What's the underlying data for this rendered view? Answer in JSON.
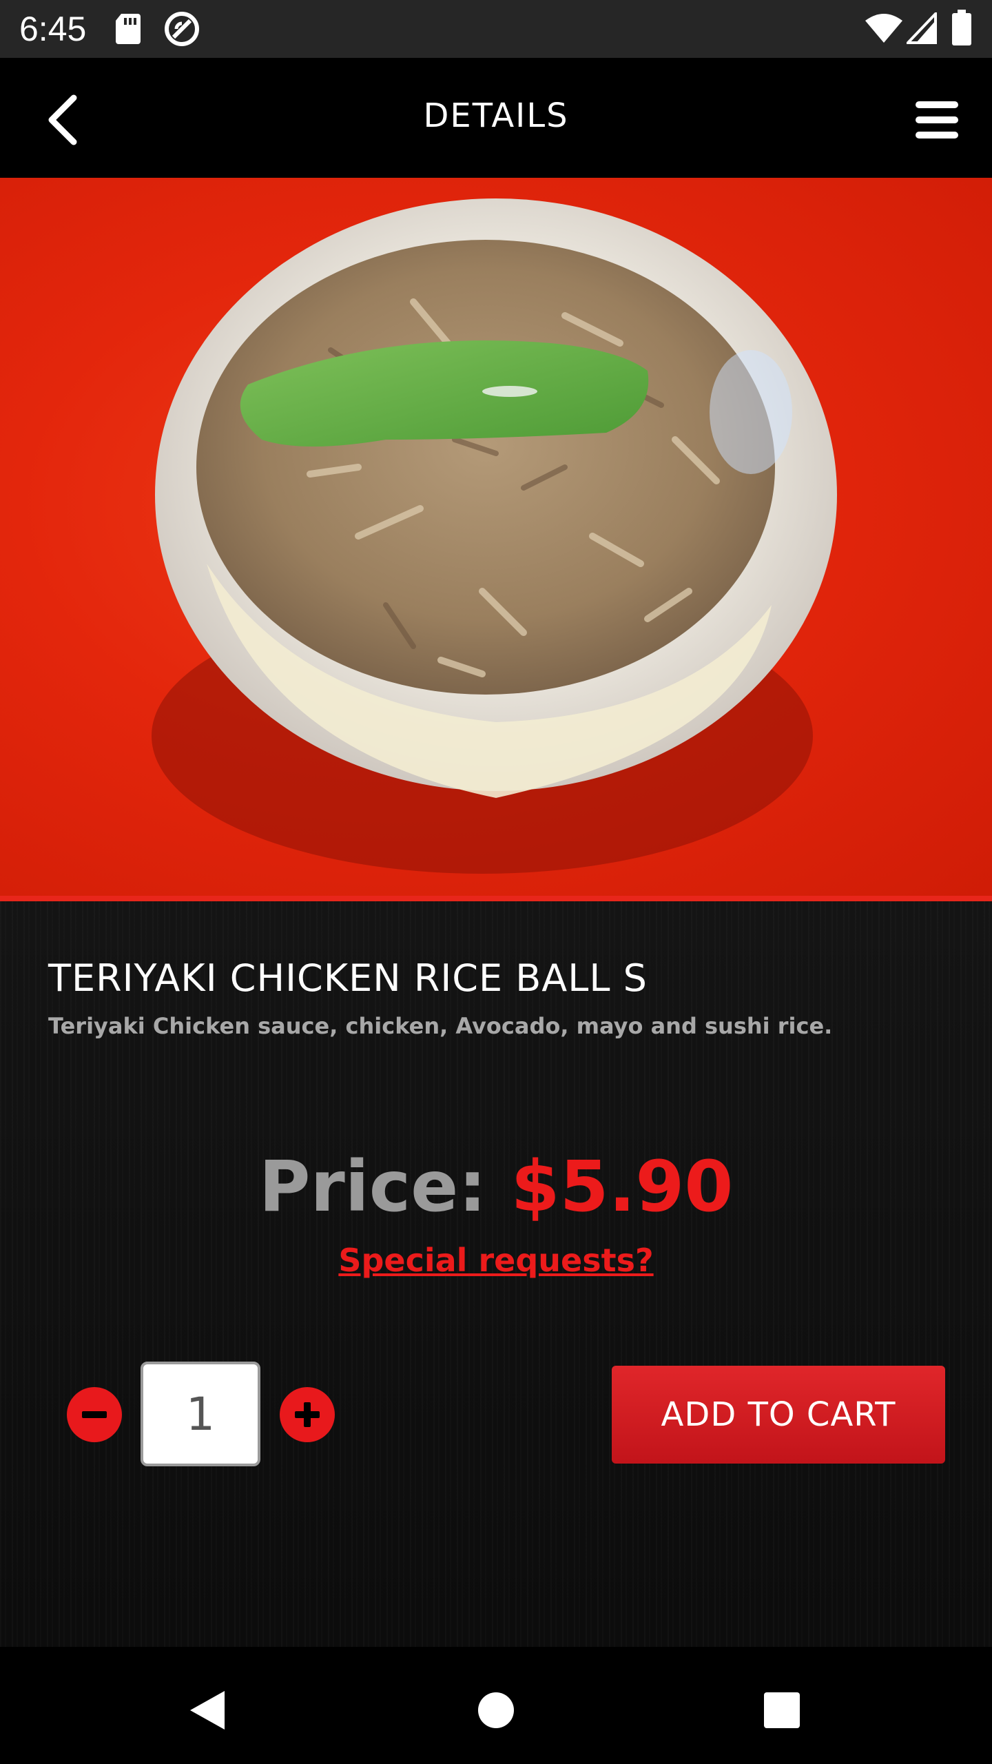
{
  "status_bar": {
    "time": "6:45",
    "icons": [
      "sd-card-icon",
      "sync-icon",
      "wifi-icon",
      "cell-signal-icon",
      "battery-icon"
    ]
  },
  "app_bar": {
    "title": "DETAILS",
    "back_icon": "chevron-left-icon",
    "menu_icon": "hamburger-menu-icon"
  },
  "hero_image": {
    "subject": "rice ball on red plate"
  },
  "item": {
    "title": "TERIYAKI CHICKEN RICE BALL S",
    "description": "Teriyaki Chicken sauce, chicken, Avocado, mayo and sushi rice.",
    "price_label": "Price:",
    "price_value": "$5.90",
    "special_requests": "Special requests?"
  },
  "order": {
    "quantity": "1",
    "minus_icon": "minus-icon",
    "plus_icon": "plus-icon",
    "add_to_cart": "ADD TO CART"
  },
  "colors": {
    "accent": "#ec1b1b",
    "background": "#0c0c0c",
    "hero_background": "#e3260c"
  },
  "nav_bar": {
    "icons": [
      "back-triangle-icon",
      "home-circle-icon",
      "recents-square-icon"
    ]
  }
}
